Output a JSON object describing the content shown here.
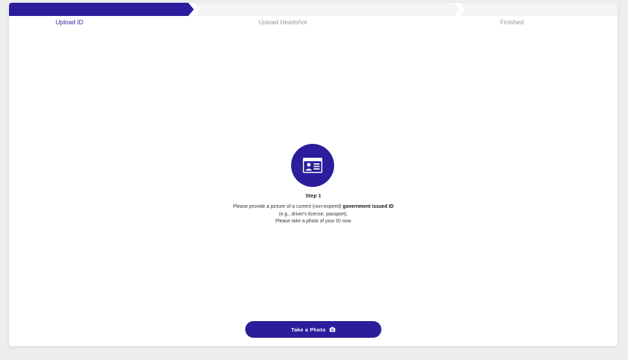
{
  "stepper": {
    "steps": [
      {
        "label": "Upload ID",
        "state": "active"
      },
      {
        "label": "Upload Headshot",
        "state": "pending"
      },
      {
        "label": "Finished",
        "state": "pending"
      }
    ]
  },
  "content": {
    "icon": "id-card-icon",
    "step_title": "Step 1",
    "instruction_prefix": "Please provide a picture of a current (non-expired) ",
    "instruction_bold": "government issued ID",
    "instruction_line2": "(e.g., driver's license, passport).",
    "instruction_line3": "Please take a photo of your ID now"
  },
  "action": {
    "take_photo_label": "Take a Photo",
    "icon": "camera-icon"
  },
  "colors": {
    "accent": "#2b1d9c",
    "active_label": "#3b2aa3",
    "inactive_segment": "#f4f4f6",
    "background": "#eeeeef"
  }
}
